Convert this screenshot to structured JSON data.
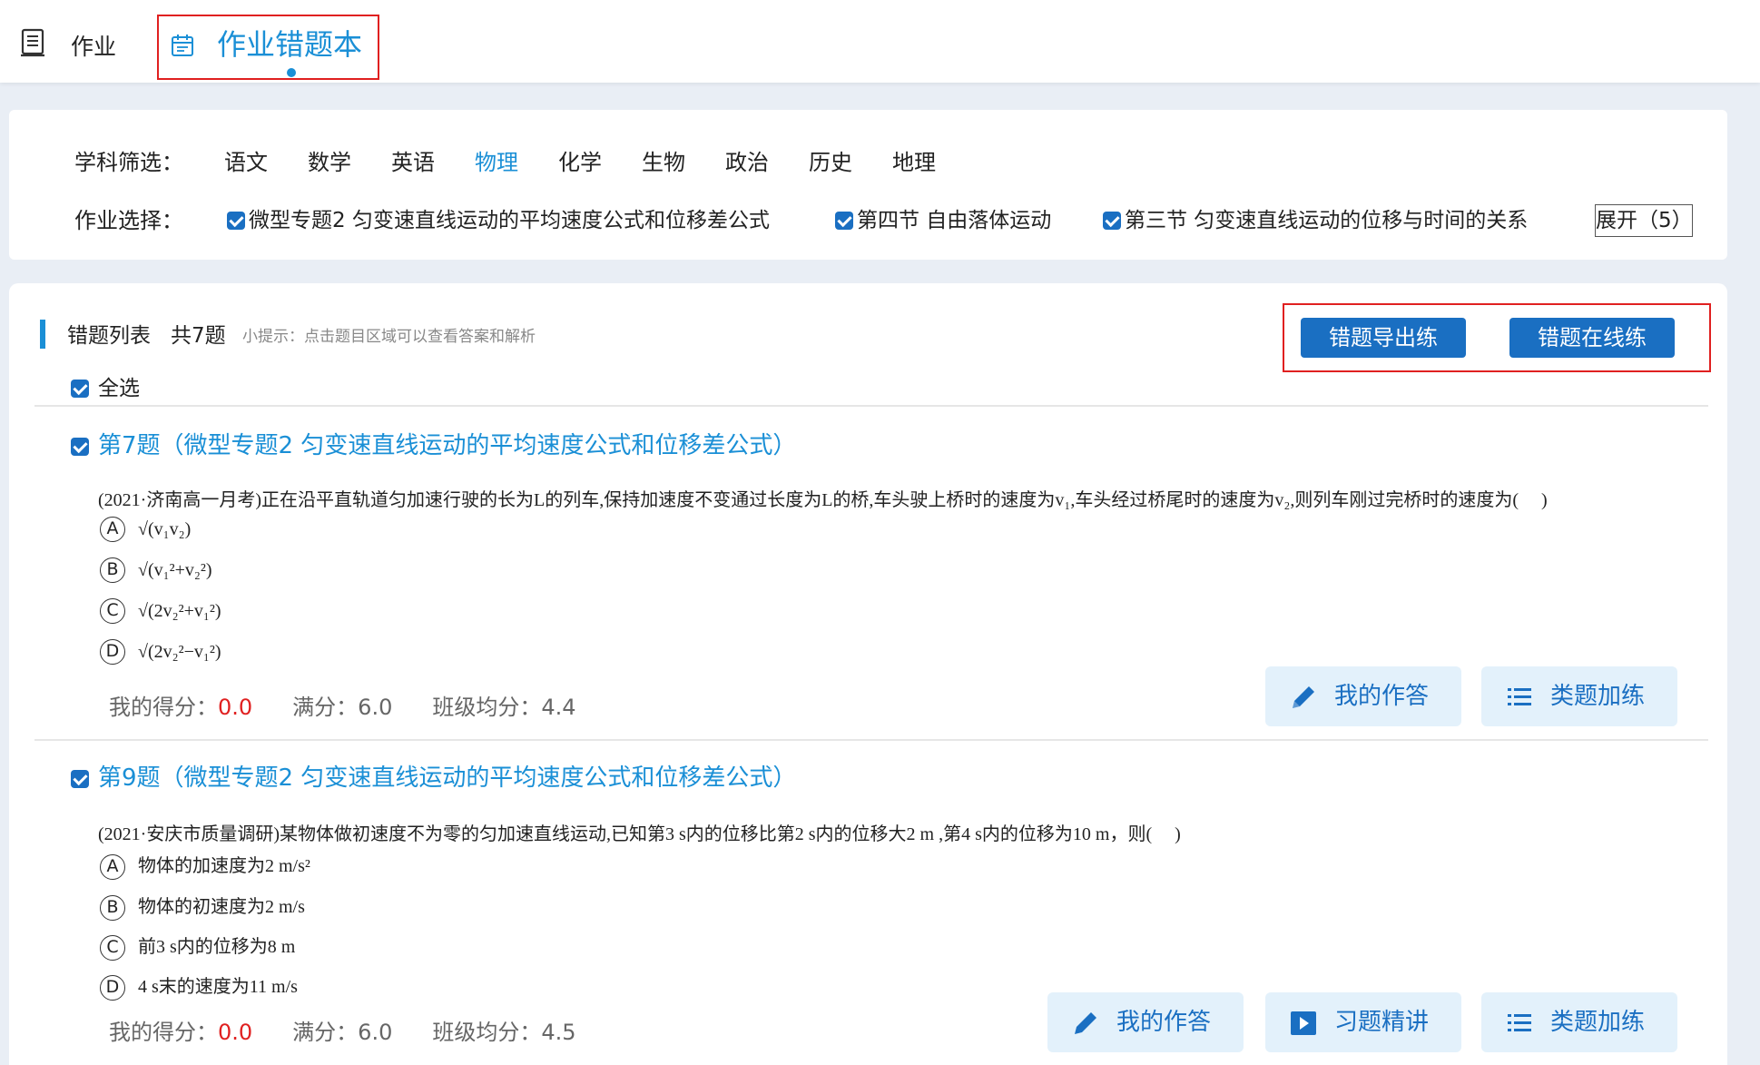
{
  "nav": {
    "homework_label": "作业",
    "wrongbook_label": "作业错题本"
  },
  "filter": {
    "subject_label": "学科筛选：",
    "subjects": [
      "语文",
      "数学",
      "英语",
      "物理",
      "化学",
      "生物",
      "政治",
      "历史",
      "地理"
    ],
    "active_subject": "物理",
    "homework_label": "作业选择：",
    "homeworks": [
      "微型专题2 匀变速直线运动的平均速度公式和位移差公式",
      "第四节  自由落体运动",
      "第三节  匀变速直线运动的位移与时间的关系"
    ],
    "expand_label": "展开（5）"
  },
  "list": {
    "title": "错题列表",
    "count": "共7题",
    "hint": "小提示：点击题目区域可以查看答案和解析",
    "export_btn": "错题导出练",
    "online_btn": "错题在线练",
    "select_all": "全选"
  },
  "questions": [
    {
      "title": "第7题（微型专题2 匀变速直线运动的平均速度公式和位移差公式）",
      "stem": "(2021·济南高一月考)正在沿平直轨道匀加速行驶的长为L的列车,保持加速度不变通过长度为L的桥,车头驶上桥时的速度为v₁,车头经过桥尾时的速度为v₂,则列车刚过完桥时的速度为(　 )",
      "options": [
        "√(v₁v₂)",
        "√(v₁²+v₂²)",
        "√(2v₂²+v₁²)",
        "√(2v₂²−v₁²)"
      ],
      "my_score_label": "我的得分：",
      "my_score": "0.0",
      "full_label": "满分：",
      "full": "6.0",
      "avg_label": "班级均分：",
      "avg": "4.4",
      "buttons": [
        "我的作答",
        "类题加练"
      ]
    },
    {
      "title": "第9题（微型专题2 匀变速直线运动的平均速度公式和位移差公式）",
      "stem": "(2021·安庆市质量调研)某物体做初速度不为零的匀加速直线运动,已知第3 s内的位移比第2 s内的位移大2 m ,第4 s内的位移为10 m，则(　 )",
      "options": [
        "物体的加速度为2 m/s²",
        "物体的初速度为2 m/s",
        "前3 s内的位移为8 m",
        "4 s末的速度为11 m/s"
      ],
      "my_score_label": "我的得分：",
      "my_score": "0.0",
      "full_label": "满分：",
      "full": "6.0",
      "avg_label": "班级均分：",
      "avg": "4.5",
      "buttons": [
        "我的作答",
        "习题精讲",
        "类题加练"
      ]
    }
  ],
  "option_letters": [
    "A",
    "B",
    "C",
    "D"
  ],
  "colors": {
    "accent": "#1a8fd6",
    "primary_btn": "#1a6fc2",
    "score_red": "#e02020",
    "highlight_box": "#e02020"
  }
}
